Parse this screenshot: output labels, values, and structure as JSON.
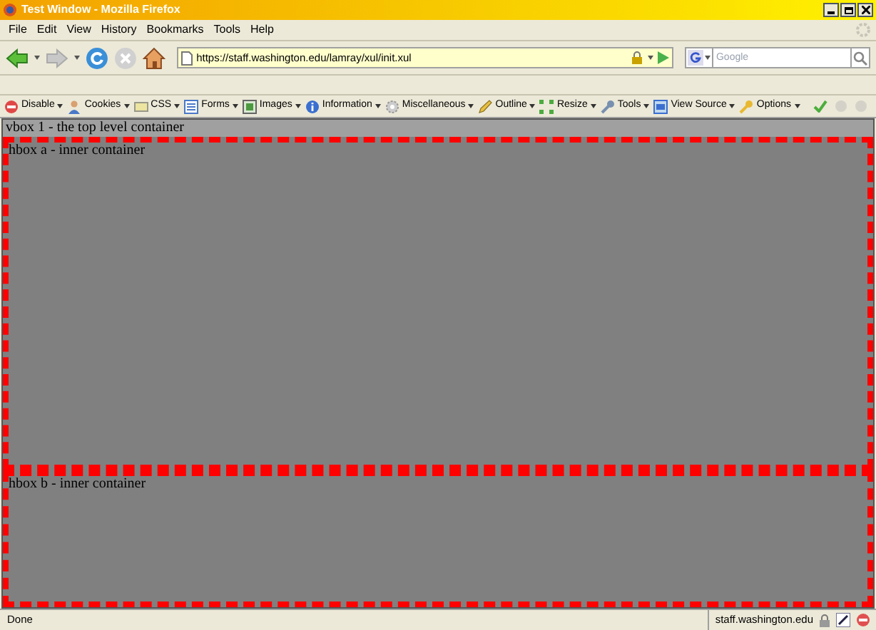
{
  "window": {
    "title": "Test Window - Mozilla Firefox"
  },
  "menu": [
    "File",
    "Edit",
    "View",
    "History",
    "Bookmarks",
    "Tools",
    "Help"
  ],
  "address": {
    "value": "https://staff.washington.edu/lamray/xul/init.xul"
  },
  "search": {
    "placeholder": "Google"
  },
  "webdev_toolbar": [
    "Disable",
    "Cookies",
    "CSS",
    "Forms",
    "Images",
    "Information",
    "Miscellaneous",
    "Outline",
    "Resize",
    "Tools",
    "View Source",
    "Options"
  ],
  "content": {
    "vbox_label": "vbox 1 - the top level container",
    "boxes": [
      {
        "label": "hbox a - inner container"
      },
      {
        "label": "hbox b - inner container"
      }
    ]
  },
  "status_bar": {
    "text": "Done",
    "host": "staff.washington.edu"
  }
}
